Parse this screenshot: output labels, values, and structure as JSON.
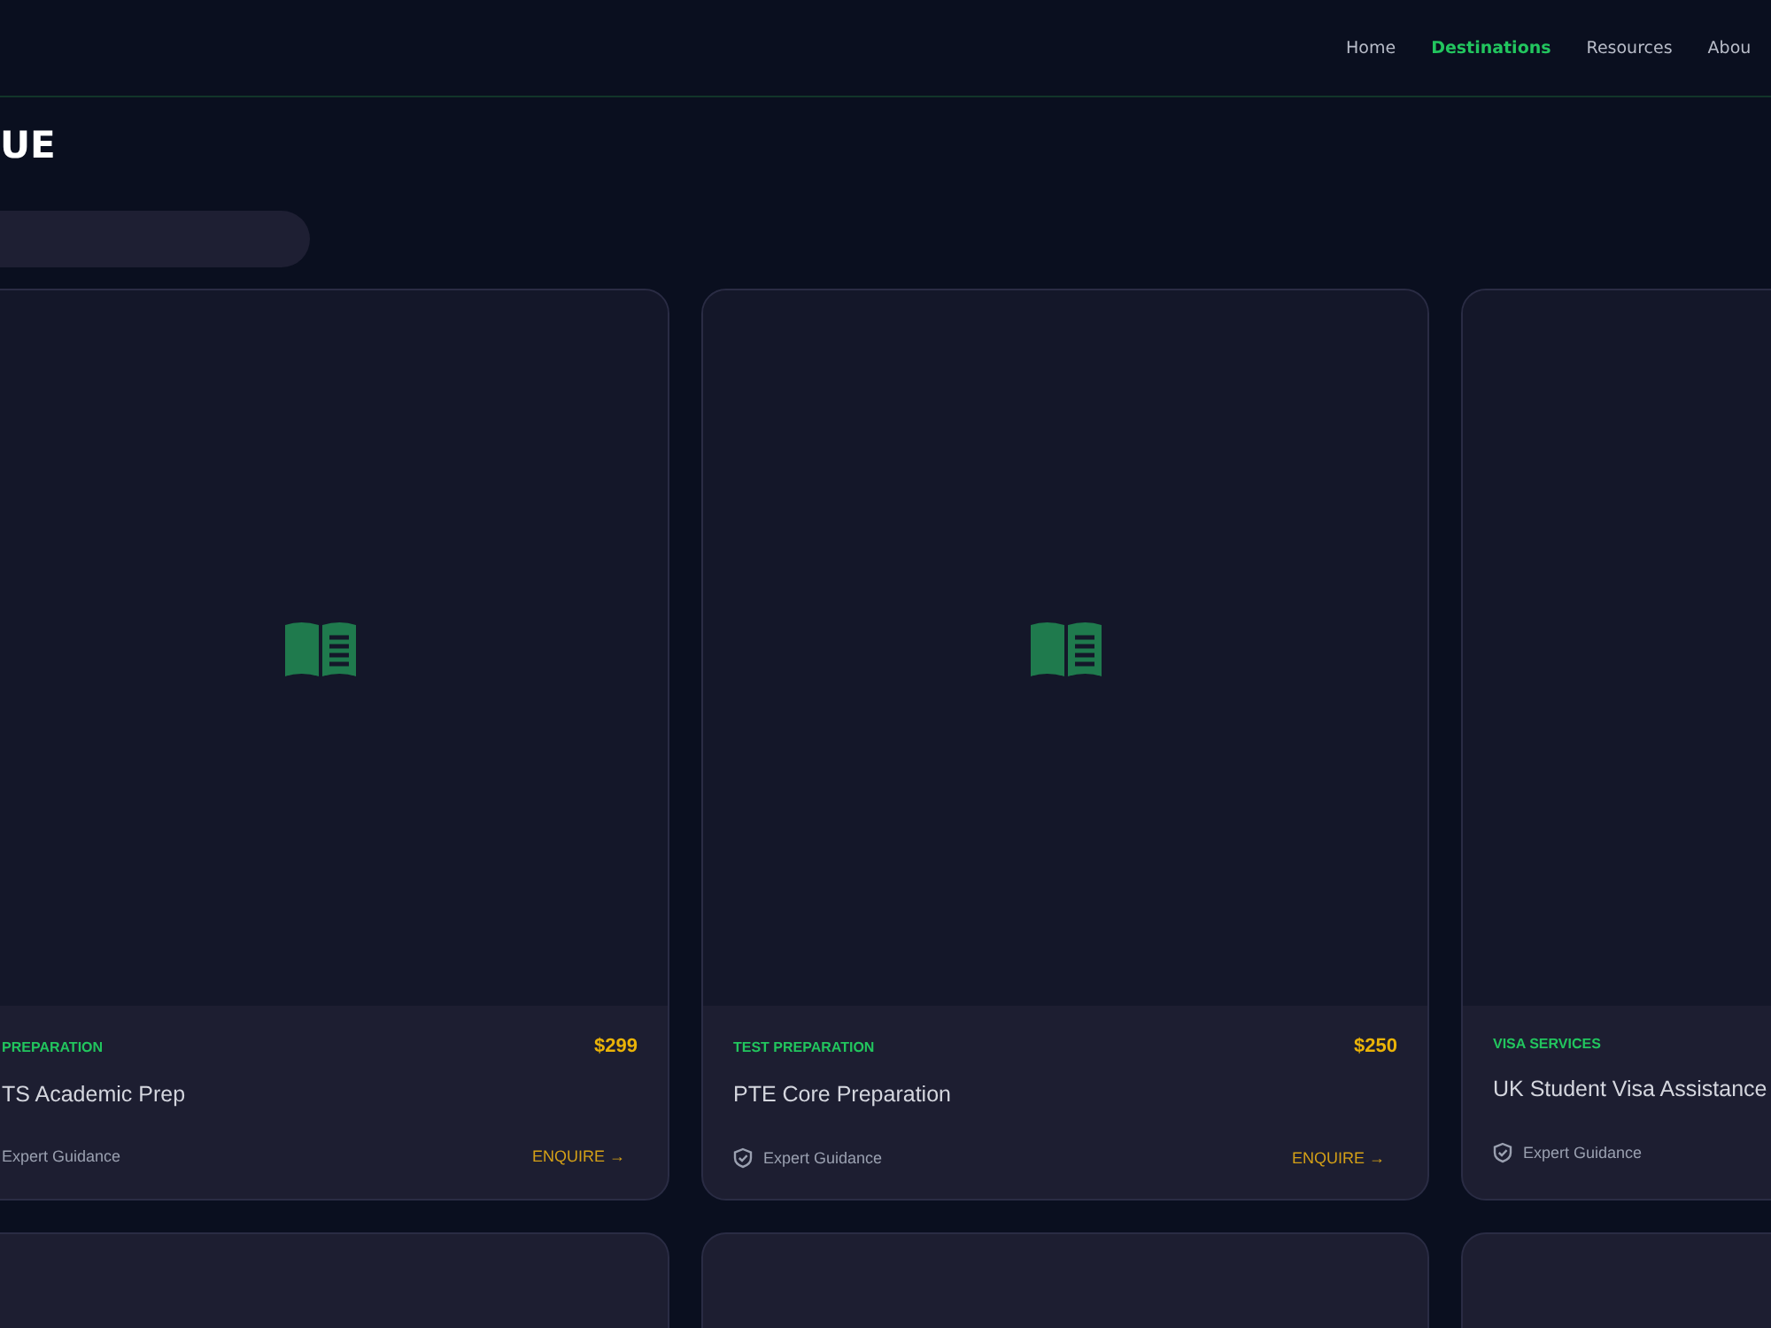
{
  "nav": {
    "items": [
      {
        "label": "Home",
        "selected": false
      },
      {
        "label": "Destinations",
        "selected": true
      },
      {
        "label": "Resources",
        "selected": false
      },
      {
        "label": "Abou",
        "selected": false
      }
    ]
  },
  "heading": "UE",
  "cards": [
    {
      "category": "PREPARATION",
      "price": "$299",
      "title": "TS Academic Prep",
      "feature": "Expert Guidance",
      "shield_icon": false,
      "action": "ENQUIRE →"
    },
    {
      "category": "TEST PREPARATION",
      "price": "$250",
      "title": "PTE Core Preparation",
      "feature": "Expert Guidance",
      "shield_icon": true,
      "action": "ENQUIRE →"
    },
    {
      "category": "VISA SERVICES",
      "title": "UK Student Visa Assistance",
      "feature": "Expert Guidance",
      "shield_icon": true
    }
  ],
  "more_cards": [
    {
      "kind": "card"
    },
    {
      "kind": "card"
    },
    {
      "kind": "card"
    }
  ]
}
